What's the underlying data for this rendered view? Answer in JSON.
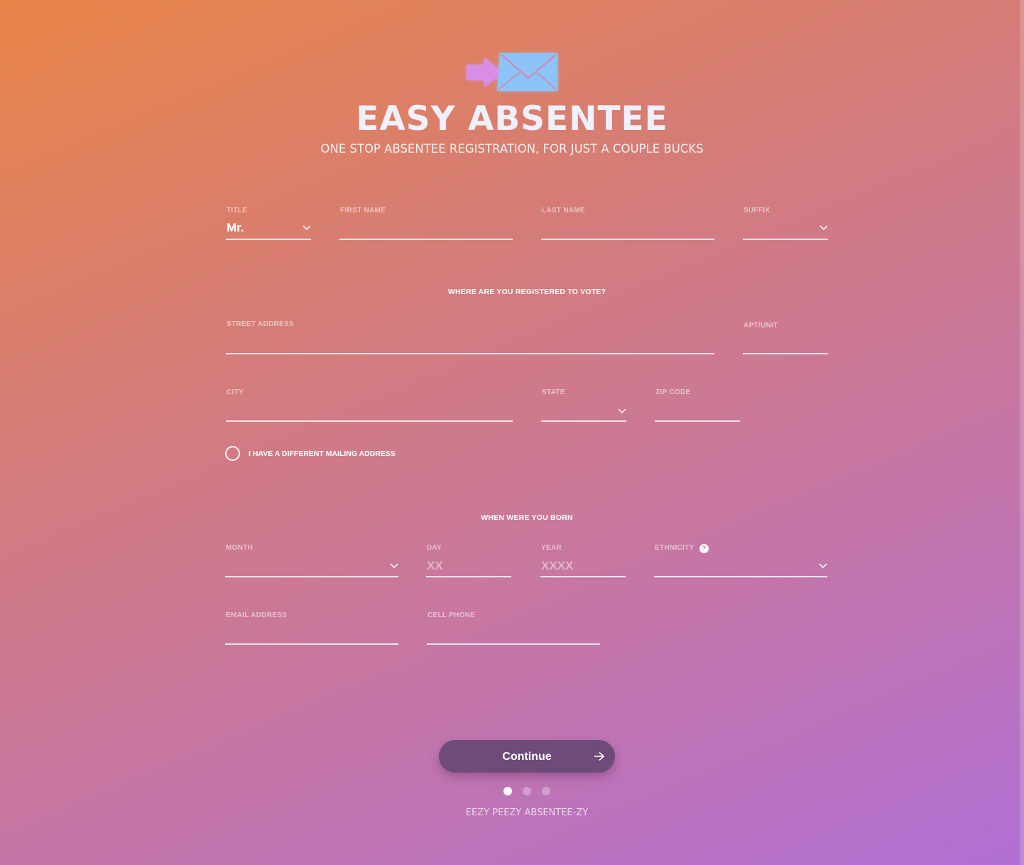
{
  "brand": {
    "logo_icon": "envelope-with-arrow-icon",
    "title": "EASY ABSENTEE",
    "subtitle": "ONE STOP ABSENTEE REGISTRATION, FOR JUST A COUPLE BUCKS"
  },
  "name_row": {
    "title_label": "TITLE",
    "title_value": "Mr.",
    "first_name_label": "FIRST NAME",
    "last_name_label": "LAST NAME",
    "suffix_label": "SUFFIX"
  },
  "registration": {
    "heading": "WHERE ARE YOU REGISTERED TO VOTE?",
    "street_label": "STREET ADDRESS",
    "apt_label": "APT/UNIT",
    "city_label": "CITY",
    "state_label": "STATE",
    "zip_label": "ZIP CODE",
    "mailing_checkbox_label": "I HAVE A DIFFERENT MAILING ADDRESS"
  },
  "birth": {
    "heading": "WHEN WERE YOU BORN",
    "month_label": "MONTH",
    "day_label": "DAY",
    "day_placeholder": "XX",
    "year_label": "YEAR",
    "year_placeholder": "XXXX",
    "ethnicity_label": "ETHNICITY",
    "ethnicity_help": "?"
  },
  "contact": {
    "email_label": "EMAIL ADDRESS",
    "phone_label": "CELL PHONE"
  },
  "actions": {
    "continue_label": "Continue",
    "continue_icon": "arrow-right-icon"
  },
  "pagination": {
    "current_step": 1,
    "total_steps": 3
  },
  "footer": {
    "text": "EEZY PEEZY ABSENTEE-ZY"
  },
  "colors": {
    "gradient_start": "#ea8548",
    "gradient_end": "#b06fd4",
    "button_bg": "#6e4b78",
    "logo_envelope": "#8cc4f7",
    "logo_arrow": "#d98ee6"
  }
}
